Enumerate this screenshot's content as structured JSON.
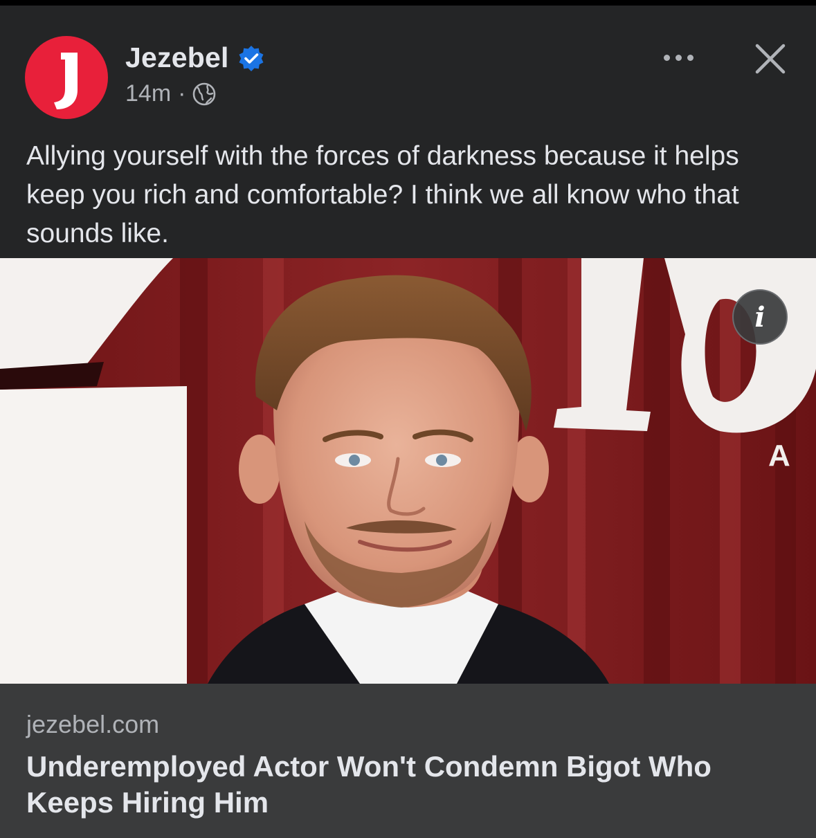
{
  "post": {
    "page_name": "Jezebel",
    "avatar_letter": "J",
    "verified_icon": "verified-badge-icon",
    "timestamp": "14m",
    "separator": "·",
    "audience_icon": "globe-icon",
    "caption": "Allying yourself with the forces of darkness because it helps keep you rich and comfortable? I think we all know who that sounds like.",
    "more_icon": "more-options-icon",
    "close_icon": "close-icon"
  },
  "image": {
    "info_glyph": "i",
    "backdrop_letters": "IO",
    "backdrop_small": "A"
  },
  "link": {
    "domain": "jezebel.com",
    "title": "Underemployed Actor Won't Condemn Bigot Who Keeps Hiring Him"
  },
  "colors": {
    "brand_red": "#e8203a",
    "verified_blue": "#1b74e4",
    "background": "#242526",
    "preview_bg": "#3a3b3c"
  }
}
